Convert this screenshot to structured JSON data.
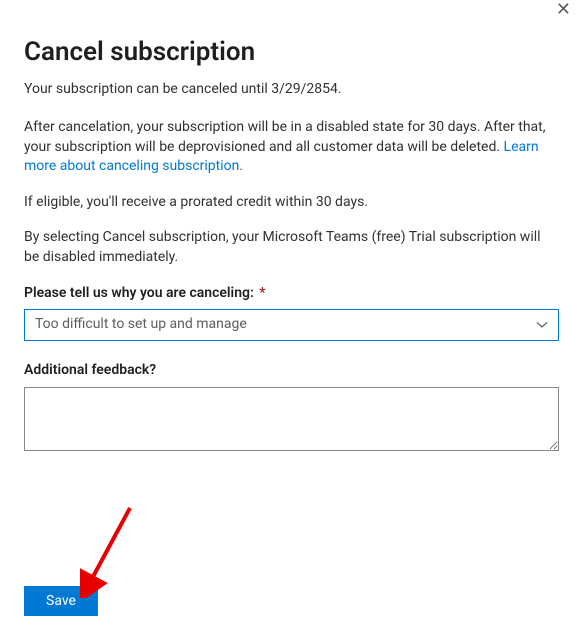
{
  "header": {
    "title": "Cancel subscription",
    "subtitle": "Your subscription can be canceled until 3/29/2854."
  },
  "body": {
    "p1_a": "After cancelation, your subscription will be in a disabled state for 30 days. After that, your subscription will be deprovisioned and all customer data will be deleted. ",
    "p1_link": "Learn more about canceling subscription.",
    "p2": "If eligible, you'll receive a prorated credit within 30 days.",
    "p3": "By selecting Cancel subscription, your Microsoft Teams (free) Trial subscription will be disabled immediately."
  },
  "form": {
    "reason_label": "Please tell us why you are canceling:",
    "required_mark": "*",
    "reason_selected": "Too difficult to set up and manage",
    "feedback_label": "Additional feedback?",
    "feedback_value": ""
  },
  "actions": {
    "save": "Save"
  }
}
